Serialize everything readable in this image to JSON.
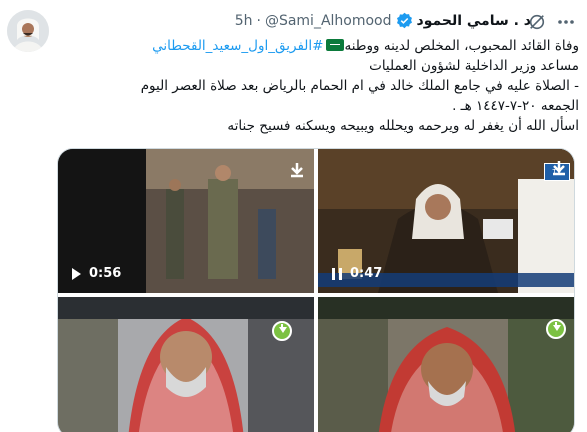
{
  "author": {
    "display_name": "د . سامي الحمود",
    "handle": "@Sami_Alhomood",
    "separator": "·",
    "time": "5h"
  },
  "tweet": {
    "line1": "وفاة القائد المحبوب، المخلص لدينه ووطنه",
    "hashtag": "#الفريق_اول_سعيد_القحطاني",
    "line2": "مساعد وزير الداخلية لشؤون العمليات",
    "line3": "- الصلاة عليه في جامع الملك خالد في ام الحمام بالرياض بعد صلاة العصر اليوم",
    "line4": "الجمعه ٢٠-٧-١٤٤٧ هـ .",
    "line5": "اسأل الله أن يغفر له ويرحمه ويحلله ويبيحه ويسكنه فسيح جناته"
  },
  "media": {
    "video1_time": "0:56",
    "video2_time": "0:47"
  },
  "icons": {
    "verified": "verified-badge-icon",
    "grok": "grok-icon",
    "more": "more-icon",
    "flag": "saudi-flag-icon",
    "play": "play-icon",
    "pause": "pause-icon",
    "download": "download-icon"
  },
  "colors": {
    "accent": "#1d9bf0",
    "text": "#0f1419",
    "muted": "#536471",
    "download_green": "#7cc142"
  }
}
